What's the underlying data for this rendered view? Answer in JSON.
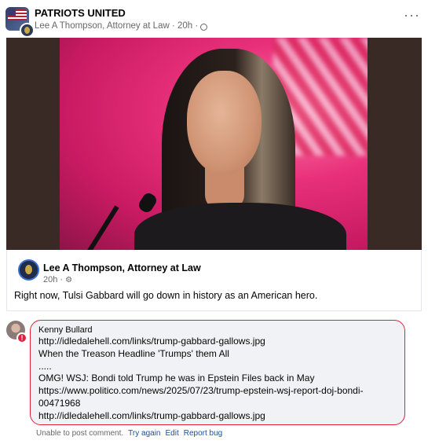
{
  "post": {
    "group_name": "PATRIOTS UNITED",
    "author_line": "Lee A Thompson, Attorney at Law · 20h ·",
    "more_label": "···"
  },
  "shared_post": {
    "author_name": "Lee A Thompson, Attorney at Law",
    "time": "20h ·",
    "text": "Right now, Tulsi Gabbard will go down in history as an American hero."
  },
  "comment": {
    "author": "Kenny Bullard",
    "lines": [
      "http://idledalehell.com/links/trump-gabbard-gallows.jpg",
      "When the Treason Headline 'Trumps' them All",
      ".....",
      "OMG! WSJ: Bondi told Trump he was in Epstein Files back in May",
      "https://www.politico.com/news/2025/07/23/trump-epstein-wsj-report-doj-bondi-",
      "00471968",
      "http://idledalehell.com/links/trump-gabbard-gallows.jpg"
    ],
    "error_badge": "!",
    "status": "Unable to post comment.",
    "actions": [
      "Try again",
      "Edit",
      "Report bug"
    ]
  }
}
